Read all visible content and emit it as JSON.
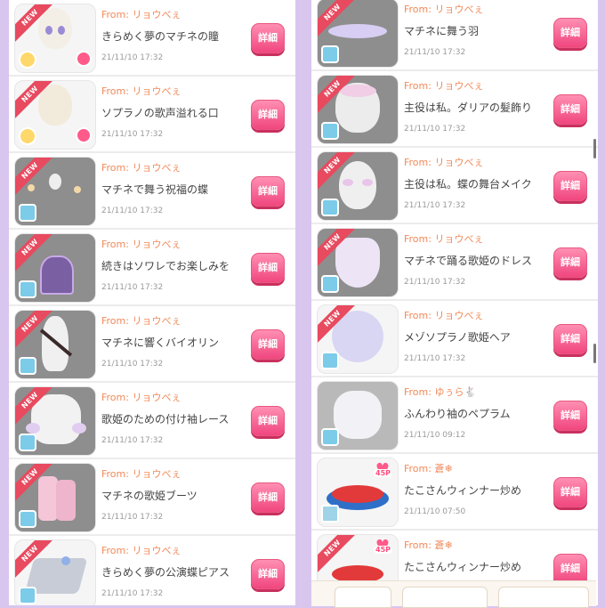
{
  "details_label": "詳細",
  "new_label": "NEW",
  "left_items": [
    {
      "from": "From: リョウべぇ",
      "title": "きらめく夢のマチネの瞳",
      "time": "21/11/10 17:32"
    },
    {
      "from": "From: リョウべぇ",
      "title": "ソプラノの歌声溢れる口",
      "time": "21/11/10 17:32"
    },
    {
      "from": "From: リョウべぇ",
      "title": "マチネで舞う祝福の蝶",
      "time": "21/11/10 17:32"
    },
    {
      "from": "From: リョウべぇ",
      "title": "続きはソワレでお楽しみを",
      "time": "21/11/10 17:32"
    },
    {
      "from": "From: リョウべぇ",
      "title": "マチネに響くバイオリン",
      "time": "21/11/10 17:32"
    },
    {
      "from": "From: リョウべぇ",
      "title": "歌姫のための付け袖レース",
      "time": "21/11/10 17:32"
    },
    {
      "from": "From: リョウべぇ",
      "title": "マチネの歌姫ブーツ",
      "time": "21/11/10 17:32"
    },
    {
      "from": "From: リョウべぇ",
      "title": "きらめく夢の公演蝶ピアス",
      "time": "21/11/10 17:32"
    }
  ],
  "right_items": [
    {
      "from": "From: リョウべぇ",
      "title": "マチネに舞う羽",
      "time": "21/11/10 17:32"
    },
    {
      "from": "From: リョウべぇ",
      "title": "主役は私。ダリアの髪飾り",
      "time": "21/11/10 17:32"
    },
    {
      "from": "From: リョウべぇ",
      "title": "主役は私。蝶の舞台メイク",
      "time": "21/11/10 17:32"
    },
    {
      "from": "From: リョウべぇ",
      "title": "マチネで踊る歌姫のドレス",
      "time": "21/11/10 17:32"
    },
    {
      "from": "From: リョウべぇ",
      "title": "メゾソプラノ歌姫ヘア",
      "time": "21/11/10 17:32"
    },
    {
      "from": "From: ゆぅら🐇",
      "title": "ふんわり袖のペプラム",
      "time": "21/11/10 09:12"
    },
    {
      "from": "From: 蒼❄",
      "title": "たこさんウィンナー炒め",
      "time": "21/11/10 07:50",
      "points": "45P"
    },
    {
      "from": "From: 蒼❄",
      "title": "たこさんウィンナー炒め",
      "time": "",
      "points": "45P"
    }
  ],
  "colors": {
    "from_text": "#f08a5a",
    "button": "#f0467f",
    "ribbon": "#e84a5f",
    "background": "#d9c6ee"
  }
}
